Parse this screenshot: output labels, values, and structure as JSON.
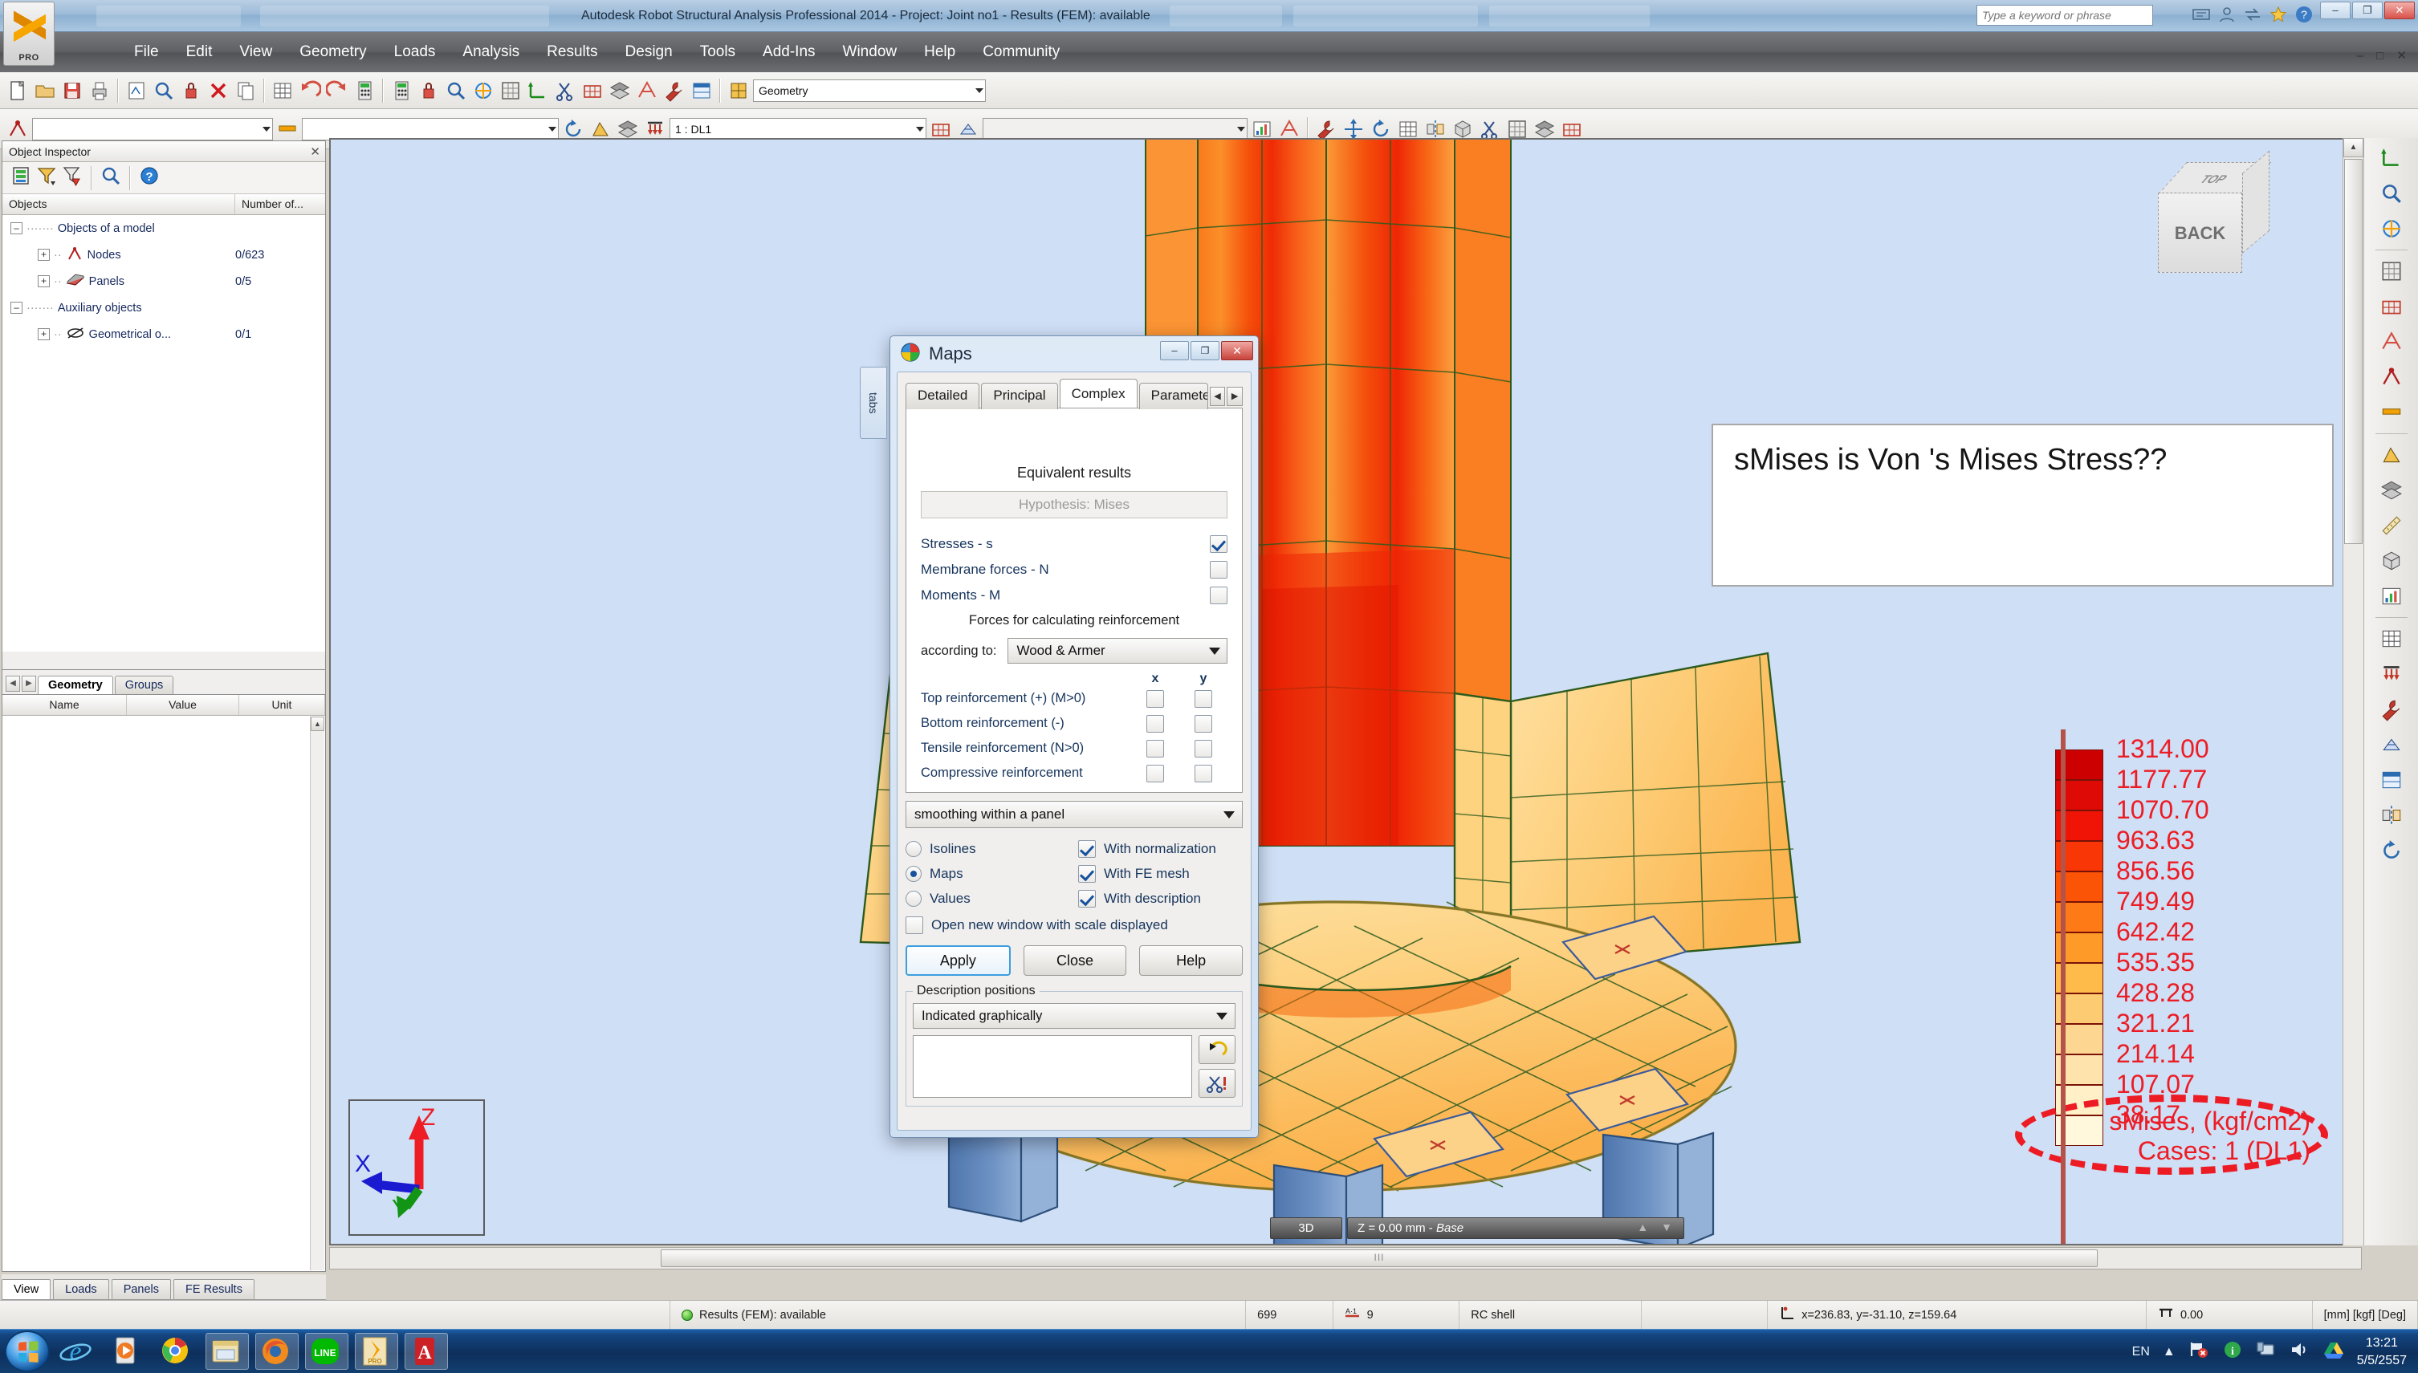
{
  "window": {
    "title": "Autodesk Robot Structural Analysis Professional 2014 - Project: Joint no1 - Results (FEM): available",
    "keyword_placeholder": "Type a keyword or phrase",
    "minimize": "–",
    "maximize": "❐",
    "close": "✕",
    "inner_minmax": "– □ ✕"
  },
  "menubar": {
    "items": [
      "File",
      "Edit",
      "View",
      "Geometry",
      "Loads",
      "Analysis",
      "Results",
      "Design",
      "Tools",
      "Add-Ins",
      "Window",
      "Help",
      "Community"
    ]
  },
  "toolbar1": {
    "layout_combo": "Geometry"
  },
  "toolbar2": {
    "case_combo": "1 : DL1",
    "blank1": "",
    "blank2": "",
    "blank3": ""
  },
  "inspector": {
    "title": "Object Inspector",
    "close": "✕",
    "columns": [
      "Objects",
      "Number of..."
    ],
    "rows": [
      {
        "label": "Objects of a model",
        "count": "",
        "indent": 0,
        "expander": "–",
        "icon": "none"
      },
      {
        "label": "Nodes",
        "count": "0/623",
        "indent": 1,
        "expander": "+",
        "icon": "node-icon"
      },
      {
        "label": "Panels",
        "count": "0/5",
        "indent": 1,
        "expander": "+",
        "icon": "panel-icon"
      },
      {
        "label": "Auxiliary objects",
        "count": "",
        "indent": 0,
        "expander": "–",
        "icon": "none"
      },
      {
        "label": "Geometrical o...",
        "count": "0/1",
        "indent": 1,
        "expander": "+",
        "icon": "geom-icon"
      }
    ],
    "tabs": [
      "Geometry",
      "Groups"
    ],
    "active_tab": "Geometry",
    "nav_prev": "◀",
    "nav_next": "▶"
  },
  "properties": {
    "columns": [
      "Name",
      "Value",
      "Unit"
    ]
  },
  "bottom_tabs": {
    "items": [
      "View",
      "Loads",
      "Panels",
      "FE Results"
    ],
    "active": "View"
  },
  "dialog": {
    "title": "Maps",
    "minimize": "–",
    "maximize": "❐",
    "close": "✕",
    "side_label": "tabs",
    "tabs": [
      "Detailed",
      "Principal",
      "Complex",
      "Parameters"
    ],
    "active_tab": "Complex",
    "tab_scroll_left": "◀",
    "tab_scroll_right": "▶",
    "section_title": "Equivalent results",
    "hypothesis": "Hypothesis: Mises",
    "checks": [
      {
        "label": "Stresses - s",
        "checked": true
      },
      {
        "label": "Membrane forces - N",
        "checked": false
      },
      {
        "label": "Moments - M",
        "checked": false
      }
    ],
    "reinforcement_title": "Forces for calculating reinforcement",
    "according_label": "according to:",
    "according_value": "Wood & Armer",
    "xy_headers": [
      "x",
      "y"
    ],
    "reinf_rows": [
      {
        "label": "Top reinforcement (+) (M>0)",
        "x": false,
        "y": false
      },
      {
        "label": "Bottom reinforcement (-)",
        "x": false,
        "y": false
      },
      {
        "label": "Tensile reinforcement (N>0)",
        "x": false,
        "y": false
      },
      {
        "label": "Compressive reinforcement",
        "x": false,
        "y": false
      }
    ],
    "smoothing": "smoothing within a panel",
    "radios": [
      {
        "label": "Isolines",
        "selected": false
      },
      {
        "label": "Maps",
        "selected": true
      },
      {
        "label": "Values",
        "selected": false
      }
    ],
    "right_checks": [
      {
        "label": "With normalization",
        "checked": true
      },
      {
        "label": "With FE mesh",
        "checked": true
      },
      {
        "label": "With description",
        "checked": true
      }
    ],
    "open_new_window": {
      "label": "Open new window with scale displayed",
      "checked": false
    },
    "buttons": {
      "apply": "Apply",
      "close": "Close",
      "help": "Help"
    },
    "desc_group": "Description positions",
    "desc_combo": "Indicated graphically",
    "desc_text": "",
    "refresh_icon": "undo-arrow-icon",
    "cut_icon": "scissors-icon"
  },
  "annotation": {
    "callout_text": "sMises is Von 's Mises Stress??"
  },
  "viewport": {
    "viewcube": {
      "front": "BACK",
      "top": "TOP"
    },
    "triad": {
      "z": "Z",
      "x": "X",
      "y": "Y"
    },
    "caption_3d": "3D",
    "caption_z": "Z = 0.00 mm - ",
    "caption_z_italic": "Base",
    "caption_updn": "▲ ▼"
  },
  "chart_data": {
    "type": "heatmap",
    "title": "sMises, (kgf/cm2)",
    "subtitle": "Cases: 1 (DL1)",
    "legend_position": "right",
    "unit": "kgf/cm2",
    "levels": [
      {
        "value": "1314.00",
        "color": "#cc0000"
      },
      {
        "value": "1177.77",
        "color": "#dd0a05"
      },
      {
        "value": "1070.70",
        "color": "#ef1405"
      },
      {
        "value": "963.63",
        "color": "#f93605"
      },
      {
        "value": "856.56",
        "color": "#fb5407"
      },
      {
        "value": "749.49",
        "color": "#fd7a16"
      },
      {
        "value": "642.42",
        "color": "#fe9a28"
      },
      {
        "value": "535.35",
        "color": "#febb49"
      },
      {
        "value": "428.28",
        "color": "#fdcb71"
      },
      {
        "value": "321.21",
        "color": "#fdd792"
      },
      {
        "value": "214.14",
        "color": "#fee3ad"
      },
      {
        "value": "107.07",
        "color": "#fff0c8"
      },
      {
        "value": "38.17",
        "color": "#fff8dd"
      }
    ]
  },
  "statusbar": {
    "result_status": "Results (FEM): available",
    "count": "699",
    "nodes_icon": "node-count-icon",
    "nodes": "9",
    "element_type": "RC shell",
    "coord_icon": "coordinates-icon",
    "coords": "x=236.83, y=-31.10, z=159.64",
    "snap_icon": "snap-icon",
    "snap": "0.00",
    "units": "[mm] [kgf] [Deg]"
  },
  "taskbar": {
    "language": "EN",
    "time": "13:21",
    "date": "5/5/2557",
    "items": [
      "internet-explorer-icon",
      "media-player-icon",
      "chrome-icon",
      "explorer-icon",
      "firefox-icon",
      "line-icon",
      "robot-pro-icon",
      "acrobat-icon"
    ],
    "tray": [
      "show-hidden-icon",
      "network-error-icon",
      "action-center-icon",
      "display-icon",
      "volume-icon",
      "google-drive-icon"
    ]
  }
}
